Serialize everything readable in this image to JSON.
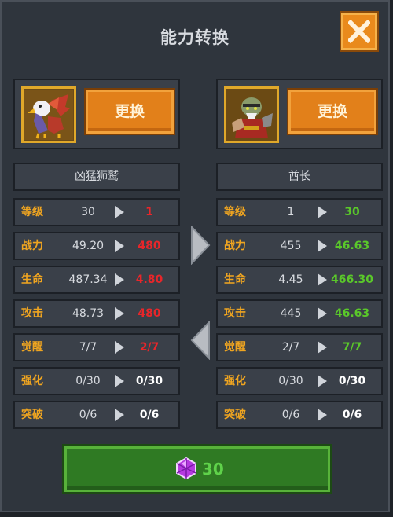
{
  "title": "能力转换",
  "swap_label": "更换",
  "left": {
    "name": "凶猛狮鹫",
    "portrait": "griffin-portrait-icon",
    "stats": [
      {
        "label": "等级",
        "current": "30",
        "new": "1",
        "color": "red"
      },
      {
        "label": "战力",
        "current": "49.20",
        "new": "480",
        "color": "red"
      },
      {
        "label": "生命",
        "current": "487.34",
        "new": "4.80",
        "color": "red"
      },
      {
        "label": "攻击",
        "current": "48.73",
        "new": "480",
        "color": "red"
      },
      {
        "label": "觉醒",
        "current": "7/7",
        "new": "2/7",
        "color": "red"
      },
      {
        "label": "强化",
        "current": "0/30",
        "new": "0/30",
        "color": "white"
      },
      {
        "label": "突破",
        "current": "0/6",
        "new": "0/6",
        "color": "white"
      }
    ]
  },
  "right": {
    "name": "酋长",
    "portrait": "chieftain-portrait-icon",
    "stats": [
      {
        "label": "等级",
        "current": "1",
        "new": "30",
        "color": "green"
      },
      {
        "label": "战力",
        "current": "455",
        "new": "46.63",
        "color": "green"
      },
      {
        "label": "生命",
        "current": "4.45",
        "new": "466.30",
        "color": "green"
      },
      {
        "label": "攻击",
        "current": "445",
        "new": "46.63",
        "color": "green"
      },
      {
        "label": "觉醒",
        "current": "2/7",
        "new": "7/7",
        "color": "green"
      },
      {
        "label": "强化",
        "current": "0/30",
        "new": "0/30",
        "color": "white"
      },
      {
        "label": "突破",
        "current": "0/6",
        "new": "0/6",
        "color": "white"
      }
    ]
  },
  "cost": {
    "value": "30",
    "icon": "purple-gem-icon"
  },
  "colors": {
    "accent": "#e2801a",
    "label": "#f0a520",
    "red": "#e8262a",
    "green": "#5ac82a",
    "panel": "#3a4049"
  }
}
